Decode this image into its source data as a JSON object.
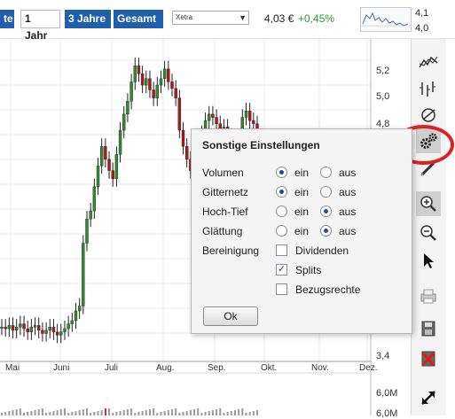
{
  "ranges": [
    {
      "label": "te",
      "state": "blue"
    },
    {
      "label": "1 Jahr",
      "state": "active"
    },
    {
      "label": "3 Jahre",
      "state": "blue"
    },
    {
      "label": "Gesamt",
      "state": "blue"
    }
  ],
  "exchange": {
    "value": "Xetra"
  },
  "quote": {
    "price": "4,03 €",
    "change": "+0,45%"
  },
  "spark_axis": {
    "high": "4,1",
    "low": "4,0"
  },
  "chart_data": {
    "type": "candlestick",
    "y_ticks": [
      "5,2",
      "5,0",
      "4,8",
      "3,4"
    ],
    "x_ticks": [
      "Mai",
      "Juni",
      "Juli",
      "Aug.",
      "Sep.",
      "Okt.",
      "Nov.",
      "Dez."
    ],
    "volume_ticks": [
      "6,0M",
      "6,0M"
    ],
    "ylim": [
      3.4,
      5.3
    ],
    "grid": true,
    "series": [
      {
        "values": [
          3.58,
          3.57,
          3.59,
          3.56,
          3.58,
          3.6,
          3.57,
          3.55,
          3.58,
          3.59,
          3.56,
          3.54,
          3.56,
          3.58,
          3.55,
          3.53,
          3.55,
          3.57,
          3.6,
          3.62,
          3.68,
          3.71,
          4.1,
          4.25,
          4.3,
          4.45,
          4.58,
          4.7,
          4.62,
          4.55,
          4.5,
          4.65,
          4.8,
          4.9,
          4.98,
          5.1,
          5.2,
          5.15,
          5.08,
          5.12,
          5.05,
          5.0,
          5.08,
          5.12,
          5.18,
          5.1,
          5.06,
          5.0,
          4.8,
          4.7,
          4.62,
          4.55,
          4.5,
          4.66,
          4.78,
          4.86,
          4.9,
          4.88,
          4.84,
          4.8,
          4.82,
          4.76,
          4.72,
          4.7,
          4.74,
          4.88,
          4.92,
          4.86,
          4.84,
          4.8
        ]
      }
    ]
  },
  "toolbar": {
    "icons": [
      "line-chart-icon",
      "ohlc-chart-icon",
      "indicator-icon",
      "settings-gears-icon",
      "draw-pen-icon",
      "zoom-in-icon",
      "zoom-out-icon",
      "cursor-icon",
      "print-icon",
      "save-icon",
      "delete-icon",
      "fullscreen-icon"
    ]
  },
  "dialog": {
    "title": "Sonstige Einstellungen",
    "rows": [
      {
        "label": "Volumen",
        "on": "ein",
        "off": "aus",
        "selected": "ein"
      },
      {
        "label": "Gitternetz",
        "on": "ein",
        "off": "aus",
        "selected": "ein"
      },
      {
        "label": "Hoch-Tief",
        "on": "ein",
        "off": "aus",
        "selected": "aus"
      },
      {
        "label": "Glättung",
        "on": "ein",
        "off": "aus",
        "selected": "aus"
      }
    ],
    "adjust_label": "Bereinigung",
    "checks": [
      {
        "label": "Dividenden",
        "checked": false
      },
      {
        "label": "Splits",
        "checked": true
      },
      {
        "label": "Bezugsrechte",
        "checked": false
      }
    ],
    "ok_label": "Ok"
  },
  "colors": {
    "brand": "#1f5fae",
    "up": "#2b9a2b",
    "candle_up": "#2e8b2e",
    "candle_down": "#b01818",
    "highlight": "#e02020"
  }
}
